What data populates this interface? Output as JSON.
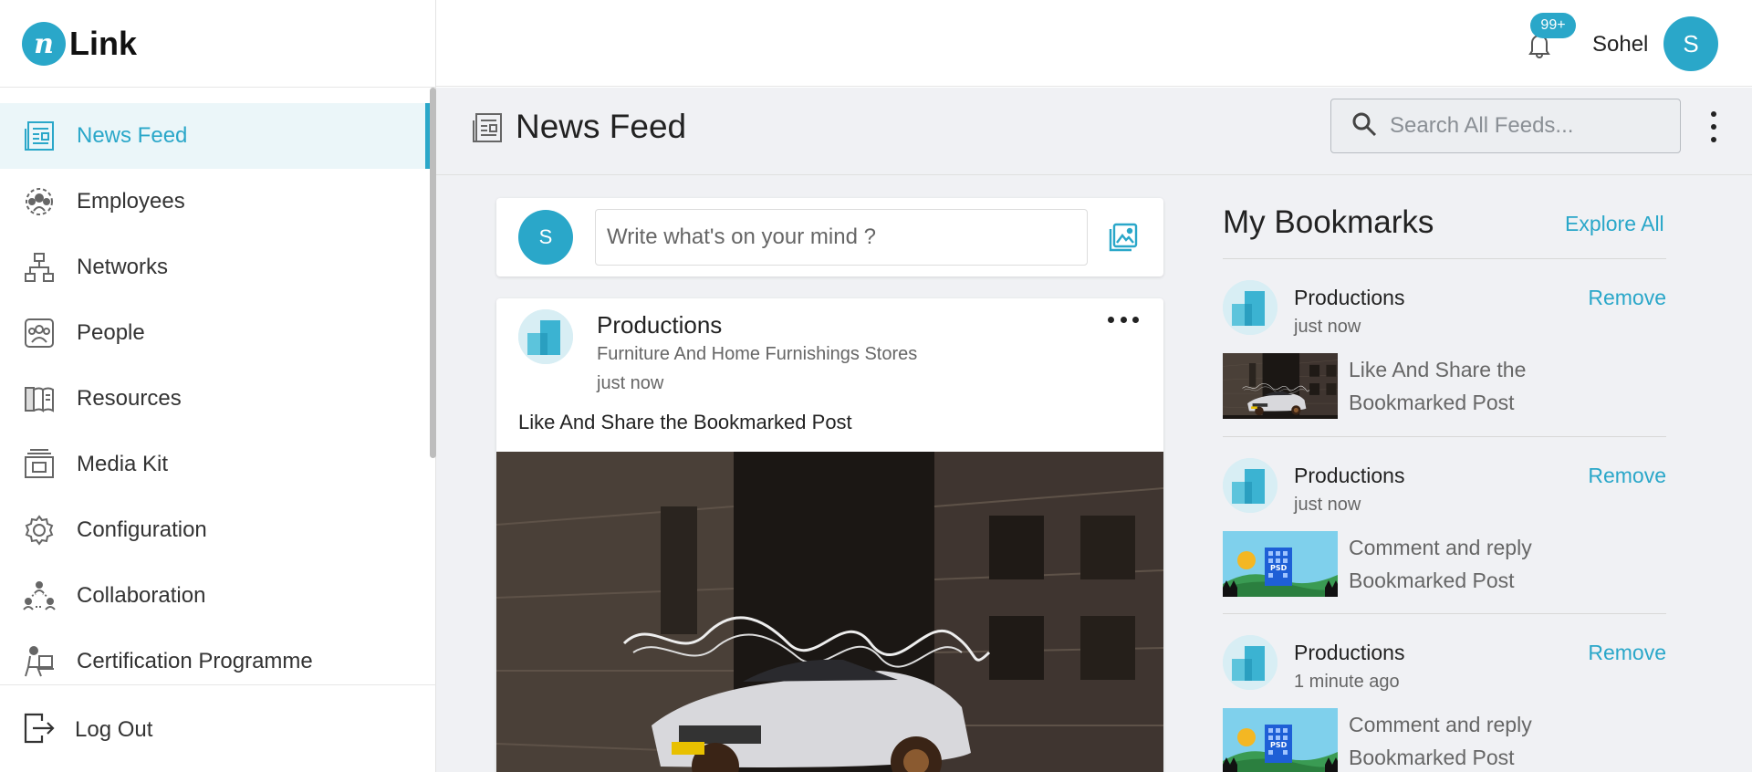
{
  "app": {
    "logo_letter": "n",
    "logo_text": "Link"
  },
  "sidebar": {
    "items": [
      {
        "label": "News Feed",
        "icon": "news-feed-icon",
        "active": true
      },
      {
        "label": "Employees",
        "icon": "employees-icon"
      },
      {
        "label": "Networks",
        "icon": "networks-icon"
      },
      {
        "label": "People",
        "icon": "people-icon"
      },
      {
        "label": "Resources",
        "icon": "resources-icon"
      },
      {
        "label": "Media Kit",
        "icon": "media-kit-icon"
      },
      {
        "label": "Configuration",
        "icon": "gear-icon"
      },
      {
        "label": "Collaboration",
        "icon": "collaboration-icon"
      },
      {
        "label": "Certification Programme",
        "icon": "certification-icon"
      }
    ],
    "logout_label": "Log Out"
  },
  "topbar": {
    "notification_badge": "99+",
    "user_name": "Sohel",
    "user_initial": "S"
  },
  "page": {
    "title": "News Feed",
    "search_placeholder": "Search All Feeds..."
  },
  "composer": {
    "avatar_initial": "S",
    "placeholder": "Write what's on your mind ?"
  },
  "post": {
    "author": "Productions",
    "category": "Furniture And Home Furnishings Stores",
    "time": "just now",
    "text": "Like And Share the Bookmarked Post"
  },
  "bookmarks": {
    "title": "My Bookmarks",
    "explore_label": "Explore All",
    "remove_label": "Remove",
    "items": [
      {
        "name": "Productions",
        "time": "just now",
        "desc_line1": "Like And Share the",
        "desc_line2": "Bookmarked Post",
        "thumb": "car-photo"
      },
      {
        "name": "Productions",
        "time": "just now",
        "desc_line1": "Comment and reply",
        "desc_line2": "Bookmarked Post",
        "thumb": "psd-illustration"
      },
      {
        "name": "Productions",
        "time": "1 minute ago",
        "desc_line1": "Comment and reply",
        "desc_line2": "Bookmarked Post",
        "thumb": "psd-illustration"
      }
    ]
  },
  "colors": {
    "accent": "#2aa7c9",
    "content_bg": "#f0f1f4",
    "active_bg": "#ebf6f9"
  }
}
